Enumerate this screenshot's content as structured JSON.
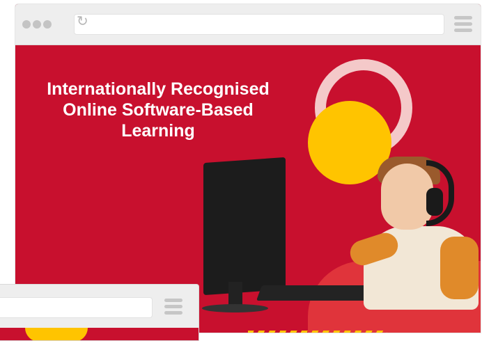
{
  "hero": {
    "title_lines": [
      "Internationally Recognised",
      "Online Software-Based",
      "Learning"
    ]
  },
  "colors": {
    "background_red": "#c8102e",
    "accent_yellow": "#ffc400",
    "ring_pink": "#f4c9c9",
    "chrome_gray": "#eeeeee"
  },
  "icons": {
    "window_controls": "three-dots-icon",
    "reload": "reload-icon",
    "menu": "hamburger-menu-icon"
  }
}
